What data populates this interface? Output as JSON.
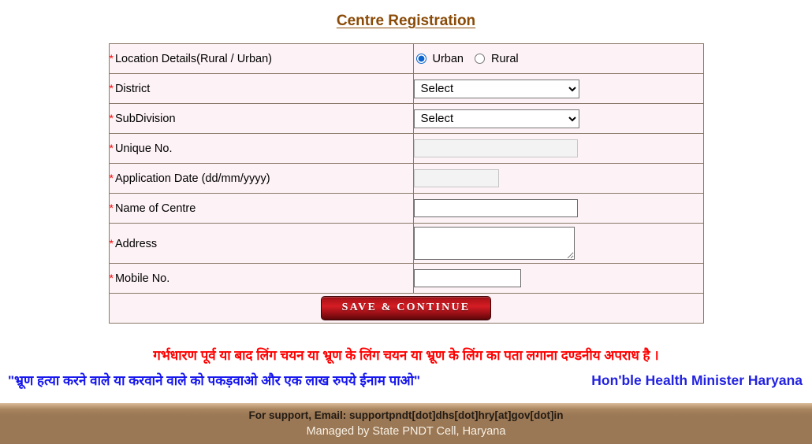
{
  "page": {
    "title": "Centre Registration"
  },
  "form": {
    "required_marker": "*",
    "rows": [
      {
        "label": "Location Details(Rural / Urban)"
      },
      {
        "label": "District"
      },
      {
        "label": "SubDivision"
      },
      {
        "label": "Unique No."
      },
      {
        "label": "Application Date (dd/mm/yyyy)"
      },
      {
        "label": "Name of Centre"
      },
      {
        "label": "Address"
      },
      {
        "label": "Mobile No."
      }
    ],
    "location": {
      "urban_label": "Urban",
      "rural_label": "Rural",
      "selected": "Urban"
    },
    "district": {
      "selected": "Select",
      "options": [
        "Select"
      ]
    },
    "subdivision": {
      "selected": "Select",
      "options": [
        "Select"
      ]
    },
    "unique_no": {
      "value": "",
      "placeholder": ""
    },
    "application_date": {
      "value": "",
      "placeholder": ""
    },
    "name_of_centre": {
      "value": "",
      "placeholder": ""
    },
    "address": {
      "value": "",
      "placeholder": ""
    },
    "mobile_no": {
      "value": "",
      "placeholder": ""
    },
    "submit_label": "SAVE  &  CONTINUE"
  },
  "notices": {
    "line1_hi": "गर्भधारण पूर्व या बाद लिंग चयन या भ्रूण के लिंग चयन या भ्रूण के लिंग का पता लगाना दण्डनीय अपराध है ।",
    "line2_hi": "\"भ्रूण हत्या करने वाले या करवाने वाले को पकड़वाओ और एक लाख रुपये ईनाम पाओ\"",
    "minister": "Hon'ble Health Minister Haryana"
  },
  "footer": {
    "support_line": "For support, Email: supportpndt[dot]dhs[dot]hry[at]gov[dot]in",
    "managed_line": "Managed by State PNDT Cell, Haryana"
  },
  "colors": {
    "title": "#8a4b08",
    "cell_bg": "#fdf2f5",
    "border": "#8a7968",
    "required": "#ff0000",
    "notice_red": "#ff0000",
    "notice_blue": "#1414ee",
    "footer_bg": "#9a7755",
    "button_red": "#b5151b"
  }
}
